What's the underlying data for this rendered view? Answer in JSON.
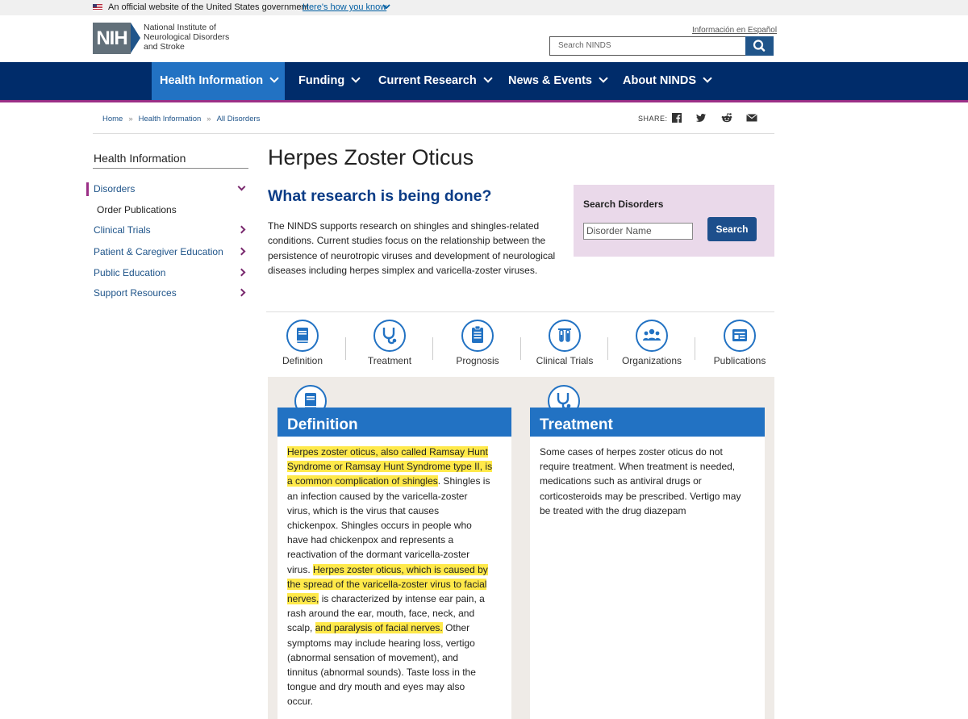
{
  "gov_banner": {
    "text": "An official website of the United States government",
    "link": "Here's how you know"
  },
  "header": {
    "logo_text": "NIH",
    "org_name_line1": "National Institute of",
    "org_name_line2": "Neurological Disorders",
    "org_name_line3": "and Stroke",
    "spanish_link": "Información en Español",
    "search_placeholder": "Search NINDS"
  },
  "nav": {
    "items": [
      {
        "label": "Health Information",
        "active": true
      },
      {
        "label": "Funding"
      },
      {
        "label": "Current Research"
      },
      {
        "label": "News & Events"
      },
      {
        "label": "About NINDS"
      }
    ]
  },
  "breadcrumb": [
    "Home",
    "Health Information",
    "All Disorders"
  ],
  "share": {
    "label": "SHARE:",
    "icons": [
      "facebook-icon",
      "twitter-icon",
      "reddit-icon",
      "email-icon"
    ]
  },
  "sidebar": {
    "title": "Health Information",
    "items": [
      {
        "label": "Disorders"
      },
      {
        "label": "Order Publications"
      },
      {
        "label": "Clinical Trials"
      },
      {
        "label": "Patient & Caregiver Education"
      },
      {
        "label": "Public Education"
      },
      {
        "label": "Support Resources"
      }
    ]
  },
  "main": {
    "title": "Herpes Zoster Oticus",
    "research_heading": "What research is being done?",
    "research_text": "The NINDS supports research on shingles and shingles-related conditions. Current studies focus on the relationship between the persistence of neurotropic viruses and development of neurological diseases including herpes simplex and varicella-zoster viruses."
  },
  "search_disorders": {
    "title": "Search Disorders",
    "placeholder": "Disorder Name",
    "button": "Search"
  },
  "tabs": [
    {
      "label": "Definition",
      "icon": "book-icon"
    },
    {
      "label": "Treatment",
      "icon": "stethoscope-icon"
    },
    {
      "label": "Prognosis",
      "icon": "clipboard-icon"
    },
    {
      "label": "Clinical Trials",
      "icon": "test-tubes-icon"
    },
    {
      "label": "Organizations",
      "icon": "people-icon"
    },
    {
      "label": "Publications",
      "icon": "newspaper-icon"
    }
  ],
  "definition_card": {
    "heading": "Definition",
    "lines": [
      [
        {
          "t": "Herpes zoster oticus, also called Ramsay Hunt",
          "hl": true
        }
      ],
      [
        {
          "t": "Syndrome or Ramsay Hunt Syndrome type II, is",
          "hl": true
        }
      ],
      [
        {
          "t": "a common complication of shingles",
          "hl": true
        },
        {
          "t": ". Shingles is",
          "hl": false
        }
      ],
      [
        {
          "t": "an infection caused by the varicella-zoster",
          "hl": false
        }
      ],
      [
        {
          "t": "virus, which is the virus that causes",
          "hl": false
        }
      ],
      [
        {
          "t": "chickenpox. Shingles occurs in people who",
          "hl": false
        }
      ],
      [
        {
          "t": "have had chickenpox and represents a",
          "hl": false
        }
      ],
      [
        {
          "t": "reactivation of the dormant varicella-zoster",
          "hl": false
        }
      ],
      [
        {
          "t": "virus. ",
          "hl": false
        },
        {
          "t": "Herpes zoster oticus, which is caused by",
          "hl": true
        }
      ],
      [
        {
          "t": "the spread of the varicella-zoster virus to facial",
          "hl": true
        }
      ],
      [
        {
          "t": "nerves,",
          "hl": true
        },
        {
          "t": " is characterized by intense ear pain, a",
          "hl": false
        }
      ],
      [
        {
          "t": "rash around the ear, mouth, face, neck, and",
          "hl": false
        }
      ],
      [
        {
          "t": "scalp, ",
          "hl": false
        },
        {
          "t": "and paralysis of facial nerves.",
          "hl": true
        },
        {
          "t": " Other",
          "hl": false
        }
      ],
      [
        {
          "t": "symptoms may include hearing loss, vertigo",
          "hl": false
        }
      ],
      [
        {
          "t": "(abnormal sensation of movement), and",
          "hl": false
        }
      ],
      [
        {
          "t": "tinnitus (abnormal sounds). Taste loss in the",
          "hl": false
        }
      ],
      [
        {
          "t": "tongue and dry mouth and eyes may also",
          "hl": false
        }
      ],
      [
        {
          "t": "occur.",
          "hl": false
        }
      ]
    ]
  },
  "treatment_card": {
    "heading": "Treatment",
    "lines": [
      "Some cases of herpes zoster oticus do not",
      "require treatment. When treatment is needed,",
      "medications such as antiviral drugs or",
      "corticosteroids may be prescribed. Vertigo may",
      "be treated with the drug diazepam"
    ]
  },
  "colors": {
    "nav_bg": "#002c6a",
    "nav_active": "#2272c3",
    "accent_purple": "#9b2f86",
    "highlight": "#ffe94a",
    "panel_bg": "#efebe7",
    "search_panel_bg": "#ead9ea"
  }
}
